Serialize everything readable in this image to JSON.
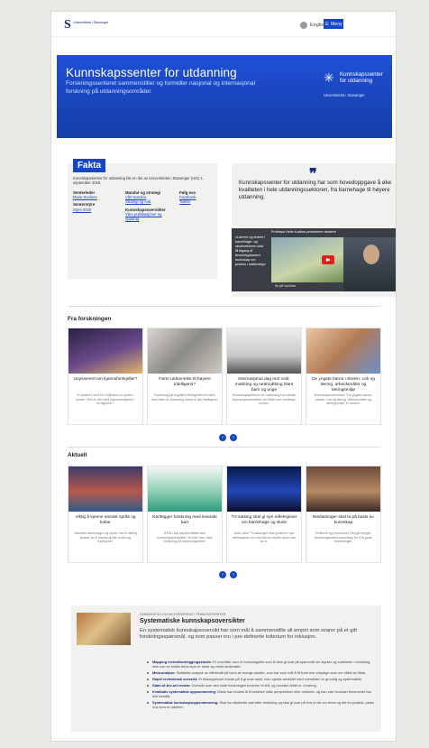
{
  "header": {
    "logo_text": "Universitetet i Stavanger",
    "language": "English",
    "menu": "Meny"
  },
  "hero": {
    "title": "Kunnskapssenter for utdanning",
    "subtitle": "Forskningssenteret sammenstiller og formidler nasjonal og internasjonal forskning på utdanningsområdet",
    "logo_name": "Kunnskapssenter for utdanning",
    "logo_university": "Universitetet i Stavanger"
  },
  "fakta": {
    "title": "Fakta",
    "intro": "Kunnskapssenter for utdanning ble en del av Universitetet i Stavanger (UiS) 1. september 2016.",
    "senterleder": "Senterleder",
    "senterleder_name": "Marie Kvalnes",
    "senterstyre": "Senterstyre",
    "senterstyre_link": "Styre 2020",
    "mandat": "Mandat og strategi",
    "mandat_link1": "Vårt mandat",
    "mandat_link2": "Strategi og mål",
    "oversikter": "Kunnskapsoversikter",
    "oversikter_link": "Våre publikasjoner og oppdrag",
    "folg": "Følg oss",
    "folg_link1": "Facebook",
    "folg_link2": "Twitter"
  },
  "quote": {
    "text": "Kunnskapssenter for utdanning har som hovedoppgave å øke kvaliteten i hele utdanningssektoren, fra barnehage til høyere utdanning.",
    "video_overlay": "«Lærere og ledere i barnehage- og skolesektoren skal få tilgang til forskningsbasert kunnskap om praksis i utdanning»",
    "video_title": "Professor Helle Kvalnes presenterer senteret",
    "video_footer": "Se på YouTube"
  },
  "forskning": {
    "heading": "Fra forskningen",
    "cards": [
      {
        "title": "Unyssenert om kjønnsforskjeller?",
        "desc": "Vi snakket med Teri Williams om gutter i skolen. Hva er det med kjønnsforskjeller i ferdigheter?"
      },
      {
        "title": "Fører utdannelse til høyere intelligens?",
        "desc": "Forskning på kognitive ferdigheter fra ulike land viser at utdanning bidrar til økt intelligens."
      },
      {
        "title": "Internasjonal dag mot vold, mobbing og nettmobbing blant barn og unge",
        "desc": "Kunnskapssenteret for utdanning har samlet kunnskapsoversikter om tiltak mot mobbing i skolen."
      },
      {
        "title": "De yngste barna i skolen: Lek og læring, arbeidsmåter og læringsmiljø",
        "desc": "Kunnskapsoversikten \"De yngste barna i skolen: Lek og læring, arbeidsmåter og læringsmiljø\" er lansert."
      }
    ]
  },
  "aktuelt": {
    "heading": "Aktuelt",
    "cards": [
      {
        "title": "Viktig å kjenne samisk språk og kultur",
        "desc": "Samiske barnehager og skoler har et særlig ansvar for å ivareta språk, kultur og tradisjoner."
      },
      {
        "title": "Kartlegger forskning med levende kart",
        "desc": "NTNU har sammenfattet sine forskningsprosjekter i et kart som viser forskning på utdanningsfeltet."
      },
      {
        "title": "TV-satsing skal gi nye refleksjoner om barnehage og skole",
        "desc": "Ulike ulike TV-satsinger skal gi lærere nye refleksjoner om hvordan en bedre skole kan se ut."
      },
      {
        "title": "Beslutninger skal ta på basis av kunnskap",
        "desc": "Rektorer og kommuner i Norge trenger forskningsbasert kunnskap for å ta gode beslutninger."
      }
    ]
  },
  "systematisk": {
    "kicker": "SAMMENSTILLING AV FORSKNING I TEMAOVERSIKTER",
    "title": "Systematiske kunnskapsoversikter",
    "lead": "En systematisk kunnskapsoversikt har som mål å sammenstille all empiri som svarer på et gitt forskningsspørsmål, og som passer inn i pre-definerte kriterium for inklusjon.",
    "items": [
      {
        "b": "Mapping review/kartleggingsstudie:",
        "t": "Et overblikk over et forskningsfelt som til dels gi svar på spørsmål om styrker og svakheter i forskning, eller kan se hvilke tema som er mest og minst undersøkt."
      },
      {
        "b": "Meta-analyse:",
        "t": "Statistisk analyse av effektmål på tvers av mange studier, som har som mål å få fram mer entydige svar om effekt av tiltak."
      },
      {
        "b": "Rapid review/rask oversikt:",
        "t": "Et tidsavgrenset forsøk på å gi svar raskt, men sjekke arbeidet med oversikten er grundig og systematisk."
      },
      {
        "b": "State-of-the-art review:",
        "t": "Oversikt over den siste forskningen innenfor et felt, og hvordan feltet er i endring."
      },
      {
        "b": "Kvalitativ systematisk oppsummering:",
        "t": "Disse kan brukes til å beskrive ulike perspektiver eller metoder, og kan vise hvordan fenomenet har blitt forstått."
      },
      {
        "b": "Systematisk kunnskapsoppsummering:",
        "t": "Skal ha utfyllende søk etter forskning og skal gi svar på hva vi vet om tema og det for praksis, pluss hva som er usikkert."
      }
    ]
  },
  "colors": {
    "accent": "#1646c8",
    "hero": "#1f4fd6"
  }
}
